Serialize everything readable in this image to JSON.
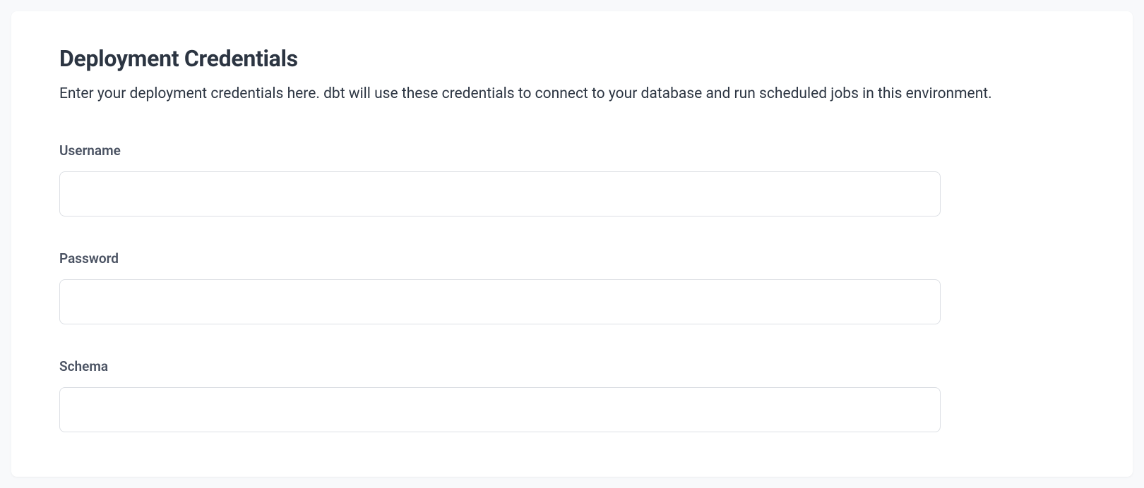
{
  "section": {
    "title": "Deployment Credentials",
    "description": "Enter your deployment credentials here. dbt will use these credentials to connect to your database and run scheduled jobs in this environment."
  },
  "fields": {
    "username": {
      "label": "Username",
      "value": "",
      "placeholder": ""
    },
    "password": {
      "label": "Password",
      "value": "",
      "placeholder": ""
    },
    "schema": {
      "label": "Schema",
      "value": "",
      "placeholder": ""
    }
  }
}
